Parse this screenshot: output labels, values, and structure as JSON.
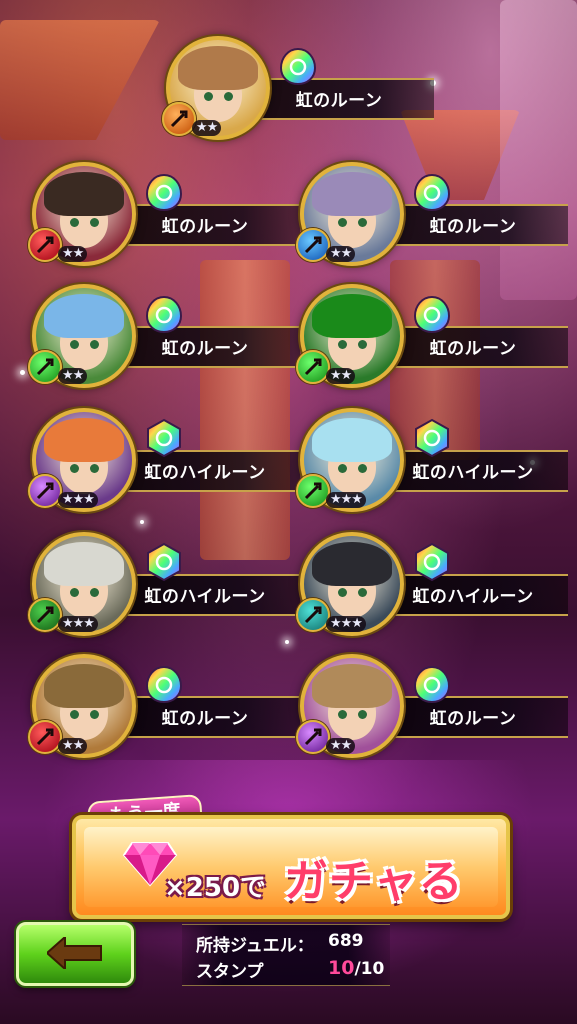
{
  "results": [
    {
      "label": "虹のルーン",
      "stars": "★★",
      "element": "orange",
      "rune": "rune",
      "hair": "#b07a4a"
    },
    {
      "label": "虹のルーン",
      "stars": "★★",
      "element": "red",
      "rune": "rune",
      "hair": "#3a2a22"
    },
    {
      "label": "虹のルーン",
      "stars": "★★",
      "element": "blue",
      "rune": "rune",
      "hair": "#9a8ab8"
    },
    {
      "label": "虹のルーン",
      "stars": "★★",
      "element": "green",
      "rune": "rune",
      "hair": "#7ab6e8"
    },
    {
      "label": "虹のルーン",
      "stars": "★★",
      "element": "green",
      "rune": "rune",
      "hair": "#1a8a1a"
    },
    {
      "label": "虹のハイルーン",
      "stars": "★★★",
      "element": "purple",
      "rune": "highrune",
      "hair": "#e87a3a"
    },
    {
      "label": "虹のハイルーン",
      "stars": "★★★",
      "element": "green",
      "rune": "highrune",
      "hair": "#a8e0f0"
    },
    {
      "label": "虹のハイルーン",
      "stars": "★★★",
      "element": "dkgreen",
      "rune": "highrune",
      "hair": "#d8d8d0"
    },
    {
      "label": "虹のハイルーン",
      "stars": "★★★",
      "element": "teal",
      "rune": "highrune",
      "hair": "#2a2a30"
    },
    {
      "label": "虹のルーン",
      "stars": "★★",
      "element": "red",
      "rune": "rune",
      "hair": "#8a6a3a"
    },
    {
      "label": "虹のルーン",
      "stars": "★★",
      "element": "purple",
      "rune": "rune",
      "hair": "#b08a5a"
    }
  ],
  "retry": {
    "label": "もう一度"
  },
  "gacha": {
    "cost": "×250で",
    "action": "ガチャる"
  },
  "wallet": {
    "jewel_label": "所持ジュエル：",
    "jewel_value": "689",
    "stamp_label": "スタンプ",
    "stamp_current": "10",
    "stamp_total": "/10"
  },
  "icons": {
    "back": "left-arrow-icon",
    "gem": "diamond-icon"
  }
}
